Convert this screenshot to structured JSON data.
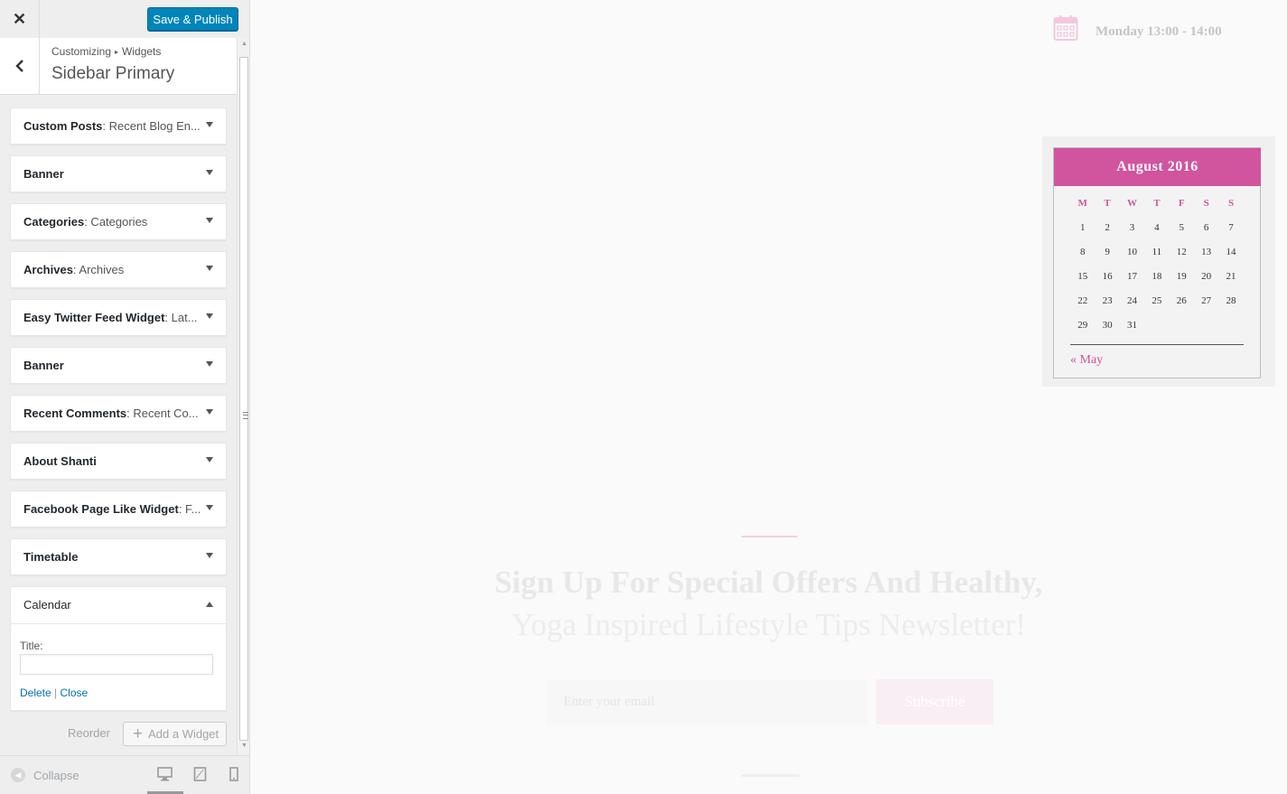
{
  "customizer": {
    "close_icon": "close-icon",
    "save_label": "Save & Publish",
    "breadcrumb": [
      "Customizing",
      "Widgets"
    ],
    "section_title": "Sidebar Primary",
    "widgets": [
      {
        "title": "Custom Posts",
        "subtitle": ": Recent Blog En..."
      },
      {
        "title": "Banner",
        "subtitle": ""
      },
      {
        "title": "Categories",
        "subtitle": ": Categories"
      },
      {
        "title": "Archives",
        "subtitle": ": Archives"
      },
      {
        "title": "Easy Twitter Feed Widget",
        "subtitle": ": Lat..."
      },
      {
        "title": "Banner",
        "subtitle": ""
      },
      {
        "title": "Recent Comments",
        "subtitle": ": Recent Co..."
      },
      {
        "title": "About Shanti",
        "subtitle": ""
      },
      {
        "title": "Facebook Page Like Widget",
        "subtitle": ": F..."
      },
      {
        "title": "Timetable",
        "subtitle": ""
      }
    ],
    "open_widget": {
      "title": "Calendar",
      "field_label": "Title:",
      "field_value": "",
      "delete_label": "Delete",
      "separator": "|",
      "close_label": "Close"
    },
    "reorder_label": "Reorder",
    "add_widget_label": "Add a Widget",
    "collapse_label": "Collapse"
  },
  "preview": {
    "timetable_text": "Monday 13:00 - 14:00",
    "calendar": {
      "caption": "August 2016",
      "day_headers": [
        "M",
        "T",
        "W",
        "T",
        "F",
        "S",
        "S"
      ],
      "weeks": [
        [
          "1",
          "2",
          "3",
          "4",
          "5",
          "6",
          "7"
        ],
        [
          "8",
          "9",
          "10",
          "11",
          "12",
          "13",
          "14"
        ],
        [
          "15",
          "16",
          "17",
          "18",
          "19",
          "20",
          "21"
        ],
        [
          "22",
          "23",
          "24",
          "25",
          "26",
          "27",
          "28"
        ],
        [
          "29",
          "30",
          "31",
          "",
          "",
          "",
          ""
        ]
      ],
      "prev_link": "« May"
    },
    "newsletter": {
      "heading_line1": "Sign Up For Special Offers And Healthy,",
      "heading_line2": "Yoga Inspired Lifestyle Tips Newsletter!",
      "email_placeholder": "Enter your email",
      "subscribe_label": "Subscribe"
    }
  },
  "colors": {
    "accent_blue": "#0085ba",
    "calendar_pink": "#d0549e",
    "link_blue": "#0073aa"
  }
}
